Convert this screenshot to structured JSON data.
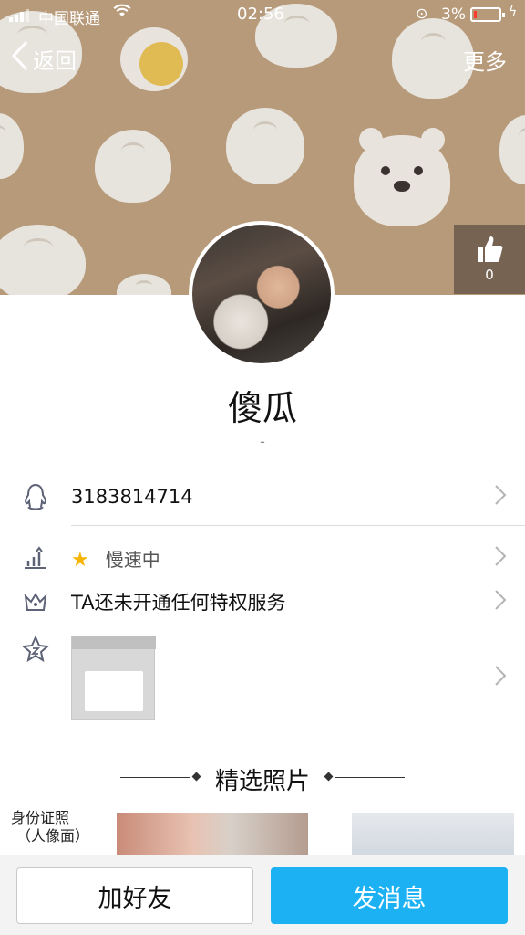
{
  "status_bar": {
    "carrier": "中国联通",
    "time": "02:56",
    "battery": "3%"
  },
  "nav": {
    "back_label": "返回",
    "more_label": "更多"
  },
  "like": {
    "count": "0"
  },
  "profile": {
    "nickname": "傻瓜",
    "signature": "-"
  },
  "info": {
    "qq_number": "3183814714",
    "level_status": "慢速中",
    "privilege": "TA还未开通任何特权服务"
  },
  "photos": {
    "section_title": "精选照片",
    "first_label_line1": "身份证照",
    "first_label_line2": "（人像面）"
  },
  "actions": {
    "add_friend": "加好友",
    "send_message": "发消息"
  },
  "colors": {
    "cover_bg": "#b79a7a",
    "primary_button": "#1cb1f2"
  }
}
